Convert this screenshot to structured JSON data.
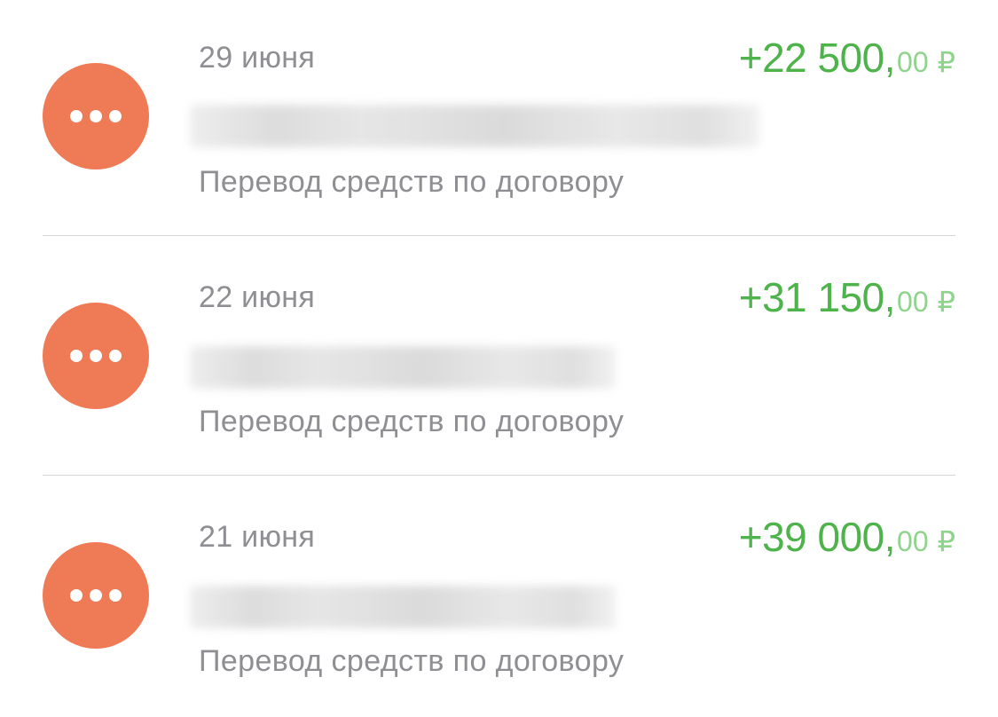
{
  "colors": {
    "avatar_bg": "#ef7a56",
    "amount_green": "#4db34a",
    "amount_green_light": "#8fd48c",
    "secondary_text": "#8e8e93",
    "divider": "#d6d6d8"
  },
  "transactions": [
    {
      "date": "29 июня",
      "amount_int": "+22 500,",
      "amount_frac": "00",
      "currency": "₽",
      "description": "Перевод средств по договору",
      "icon": "more-dots-icon"
    },
    {
      "date": "22 июня",
      "amount_int": "+31 150,",
      "amount_frac": "00",
      "currency": "₽",
      "description": "Перевод средств по договору",
      "icon": "more-dots-icon"
    },
    {
      "date": "21 июня",
      "amount_int": "+39 000,",
      "amount_frac": "00",
      "currency": "₽",
      "description": "Перевод средств по договору",
      "icon": "more-dots-icon"
    }
  ]
}
